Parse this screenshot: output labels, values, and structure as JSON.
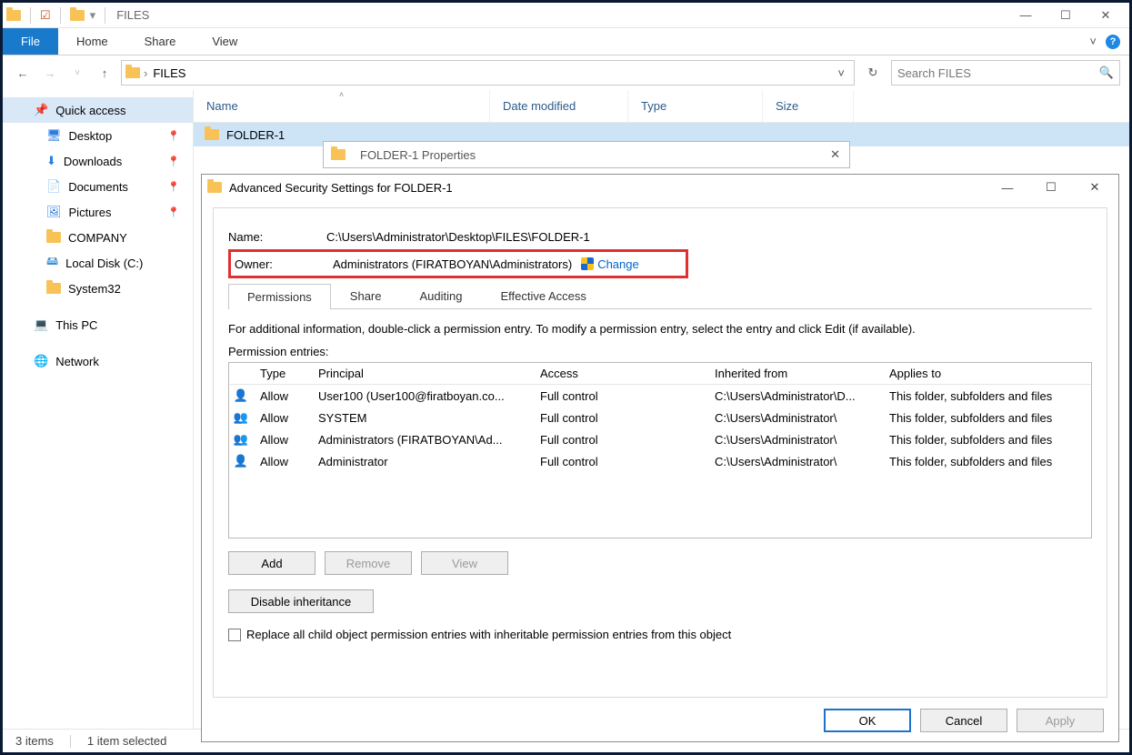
{
  "window": {
    "title": "FILES",
    "minimize": "—",
    "maximize": "☐",
    "close": "✕"
  },
  "ribbon": {
    "file": "File",
    "home": "Home",
    "share": "Share",
    "view": "View",
    "chevron": "˅",
    "help": "?"
  },
  "nav": {
    "back": "←",
    "forward": "→",
    "dropdown": "˅",
    "up": "↑",
    "crumb_root": "",
    "chev": "›",
    "crumb1": "FILES",
    "address_drop": "˅",
    "refresh": "↻",
    "search_placeholder": "Search FILES",
    "search_icon": "🔍"
  },
  "sidebar": {
    "quick_access": "Quick access",
    "desktop": "Desktop",
    "downloads": "Downloads",
    "documents": "Documents",
    "pictures": "Pictures",
    "company": "COMPANY",
    "local_disk": "Local Disk (C:)",
    "system32": "System32",
    "this_pc": "This PC",
    "network": "Network"
  },
  "columns": {
    "name": "Name",
    "date": "Date modified",
    "type": "Type",
    "size": "Size"
  },
  "files": {
    "row1": "FOLDER-1"
  },
  "status": {
    "count": "3 items",
    "selected": "1 item selected"
  },
  "properties_tab": {
    "title": "FOLDER-1 Properties",
    "close": "✕"
  },
  "adv": {
    "title": "Advanced Security Settings for FOLDER-1",
    "min": "—",
    "max": "☐",
    "close": "✕",
    "name_lbl": "Name:",
    "name_val": "C:\\Users\\Administrator\\Desktop\\FILES\\FOLDER-1",
    "owner_lbl": "Owner:",
    "owner_val": "Administrators (FIRATBOYAN\\Administrators)",
    "change": "Change",
    "tabs": {
      "permissions": "Permissions",
      "share": "Share",
      "auditing": "Auditing",
      "effective": "Effective Access"
    },
    "info": "For additional information, double-click a permission entry. To modify a permission entry, select the entry and click Edit (if available).",
    "entries_lbl": "Permission entries:",
    "headers": {
      "type": "Type",
      "principal": "Principal",
      "access": "Access",
      "inherited": "Inherited from",
      "applies": "Applies to"
    },
    "rows": [
      {
        "icon": "👤",
        "type": "Allow",
        "principal": "User100 (User100@firatboyan.co...",
        "access": "Full control",
        "inherited": "C:\\Users\\Administrator\\D...",
        "applies": "This folder, subfolders and files"
      },
      {
        "icon": "👥",
        "type": "Allow",
        "principal": "SYSTEM",
        "access": "Full control",
        "inherited": "C:\\Users\\Administrator\\",
        "applies": "This folder, subfolders and files"
      },
      {
        "icon": "👥",
        "type": "Allow",
        "principal": "Administrators (FIRATBOYAN\\Ad...",
        "access": "Full control",
        "inherited": "C:\\Users\\Administrator\\",
        "applies": "This folder, subfolders and files"
      },
      {
        "icon": "👤",
        "type": "Allow",
        "principal": "Administrator",
        "access": "Full control",
        "inherited": "C:\\Users\\Administrator\\",
        "applies": "This folder, subfolders and files"
      }
    ],
    "add": "Add",
    "remove": "Remove",
    "view": "View",
    "disable_inh": "Disable inheritance",
    "replace": "Replace all child object permission entries with inheritable permission entries from this object",
    "ok": "OK",
    "cancel": "Cancel",
    "apply": "Apply"
  }
}
